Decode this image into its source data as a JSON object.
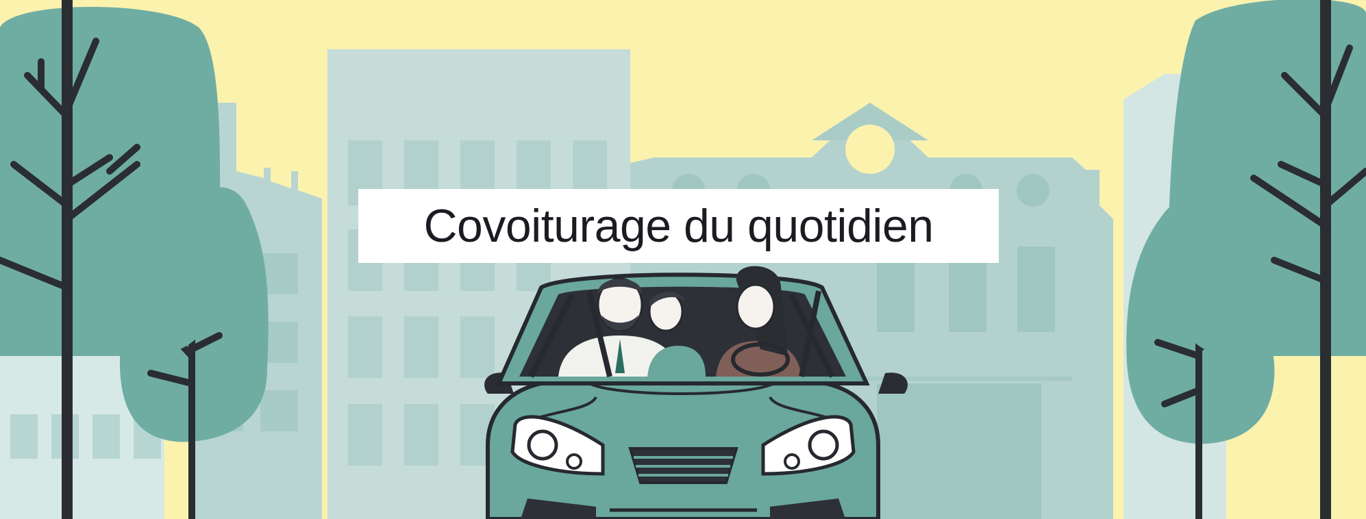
{
  "banner": {
    "title": "Covoiturage du quotidien"
  },
  "colors": {
    "sky": "#fbf2ae",
    "building_light": "#c5dcd9",
    "building_mid": "#9fc7c0",
    "tree": "#6fada3",
    "car_body": "#6aa79d",
    "outline": "#26292f"
  },
  "illustration": {
    "subject": "car-with-three-passengers",
    "background": "city-buildings-and-trees"
  }
}
